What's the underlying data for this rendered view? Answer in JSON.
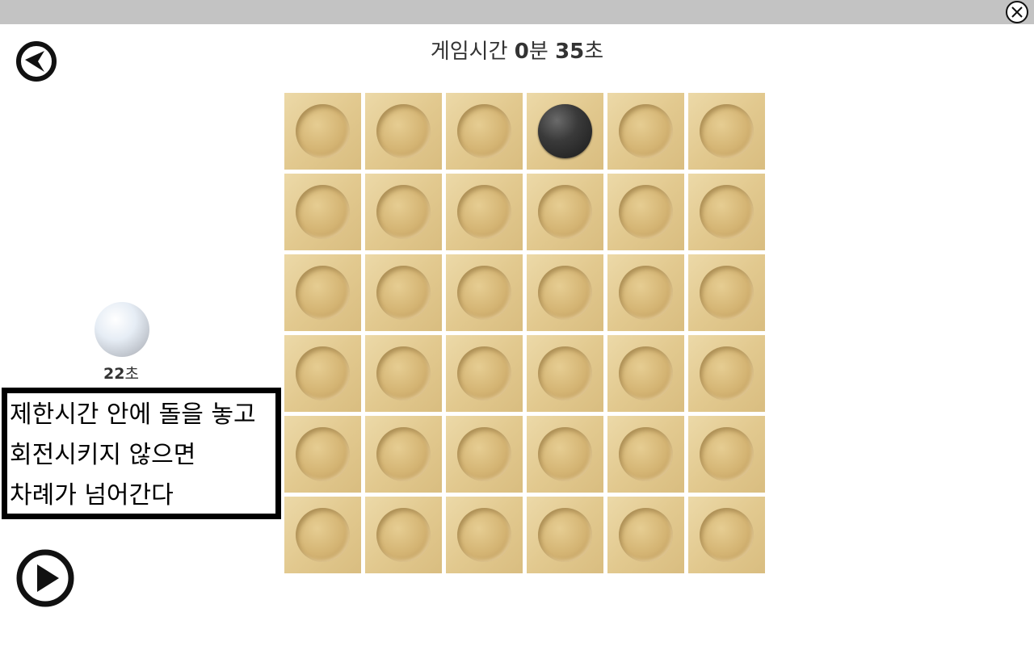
{
  "header": {
    "timer_label": "게임시간",
    "timer_minutes": "0",
    "timer_min_unit": "분",
    "timer_seconds": "35",
    "timer_sec_unit": "초"
  },
  "controls": {
    "close_icon": "close-icon",
    "back_icon": "back-arrow-icon",
    "play_icon": "play-icon"
  },
  "player": {
    "stone_color": "white",
    "time_value": "22",
    "time_unit": "초"
  },
  "rule": {
    "lines": [
      "제한시간 안에 돌을 놓고",
      "회전시키지 않으면",
      "차례가 넘어간다"
    ]
  },
  "board": {
    "rows": 6,
    "cols": 6,
    "cells": [
      [
        "empty",
        "empty",
        "empty",
        "black",
        "empty",
        "empty"
      ],
      [
        "empty",
        "empty",
        "empty",
        "empty",
        "empty",
        "empty"
      ],
      [
        "empty",
        "empty",
        "empty",
        "empty",
        "empty",
        "empty"
      ],
      [
        "empty",
        "empty",
        "empty",
        "empty",
        "empty",
        "empty"
      ],
      [
        "empty",
        "empty",
        "empty",
        "empty",
        "empty",
        "empty"
      ],
      [
        "empty",
        "empty",
        "empty",
        "empty",
        "empty",
        "empty"
      ]
    ]
  },
  "colors": {
    "topbar": "#c3c3c3",
    "board_cell": "#e2c98f",
    "black_stone": "#2a2a2a",
    "white_stone": "#e8eef4"
  }
}
